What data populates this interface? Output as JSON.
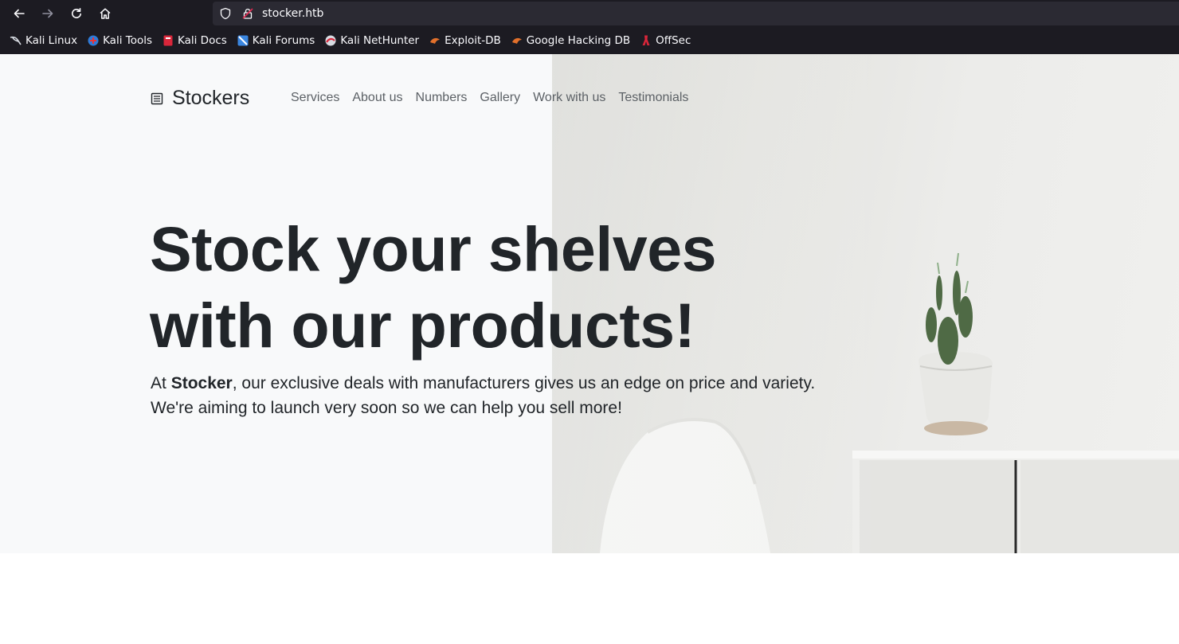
{
  "browser": {
    "url": "stocker.htb",
    "bookmarks": [
      {
        "label": "Kali Linux",
        "icon": "kali-dragon-icon"
      },
      {
        "label": "Kali Tools",
        "icon": "kali-tools-icon"
      },
      {
        "label": "Kali Docs",
        "icon": "kali-docs-icon"
      },
      {
        "label": "Kali Forums",
        "icon": "kali-forums-icon"
      },
      {
        "label": "Kali NetHunter",
        "icon": "kali-nethunter-icon"
      },
      {
        "label": "Exploit-DB",
        "icon": "exploit-db-icon"
      },
      {
        "label": "Google Hacking DB",
        "icon": "ghdb-icon"
      },
      {
        "label": "OffSec",
        "icon": "offsec-icon"
      }
    ]
  },
  "site": {
    "brand": "Stockers",
    "nav": [
      "Services",
      "About us",
      "Numbers",
      "Gallery",
      "Work with us",
      "Testimonials"
    ],
    "headline_line1": "Stock your shelves",
    "headline_line2": "with our products!",
    "lead_prefix": "At ",
    "lead_company": "Stocker",
    "lead_rest": ", our exclusive deals with manufacturers gives us an edge on price and variety. We're aiming to launch very soon so we can help you sell more!"
  },
  "colors": {
    "chrome_bg": "#1c1b22",
    "urlbar_bg": "#2b2a33",
    "hero_bg": "#f8f9fa",
    "text_dark": "#212529",
    "nav_text": "#5c6166"
  }
}
